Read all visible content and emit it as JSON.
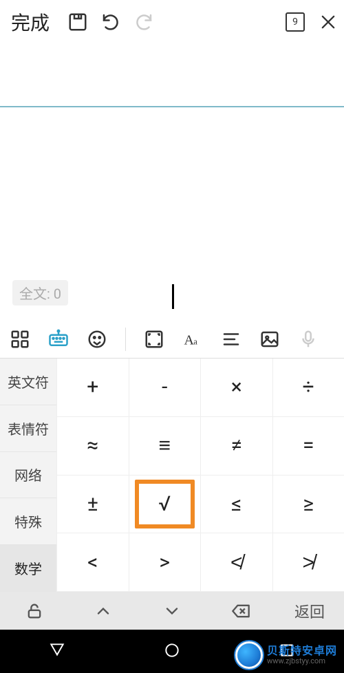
{
  "topbar": {
    "done_label": "完成",
    "page_indicator": "9"
  },
  "title": {
    "text": ""
  },
  "word_count": {
    "label": "全文: 0"
  },
  "categories": [
    {
      "label": "英文符",
      "active": false
    },
    {
      "label": "表情符",
      "active": false
    },
    {
      "label": "网络",
      "active": false
    },
    {
      "label": "特殊",
      "active": false
    },
    {
      "label": "数学",
      "active": true
    }
  ],
  "symbols": [
    [
      {
        "g": "+"
      },
      {
        "g": "-"
      },
      {
        "g": "×"
      },
      {
        "g": "÷"
      }
    ],
    [
      {
        "g": "≈"
      },
      {
        "g": "≡"
      },
      {
        "g": "≠"
      },
      {
        "g": "="
      }
    ],
    [
      {
        "g": "±"
      },
      {
        "g": "√",
        "highlight": true
      },
      {
        "g": "≤"
      },
      {
        "g": "≥"
      }
    ],
    [
      {
        "g": "<"
      },
      {
        "g": ">"
      },
      {
        "g": "≮"
      },
      {
        "g": "≯"
      }
    ]
  ],
  "ime_bottom": {
    "back_label": "返回"
  },
  "watermark": {
    "brand": "贝斯特安卓网",
    "url": "www.zjbstyy.com"
  }
}
